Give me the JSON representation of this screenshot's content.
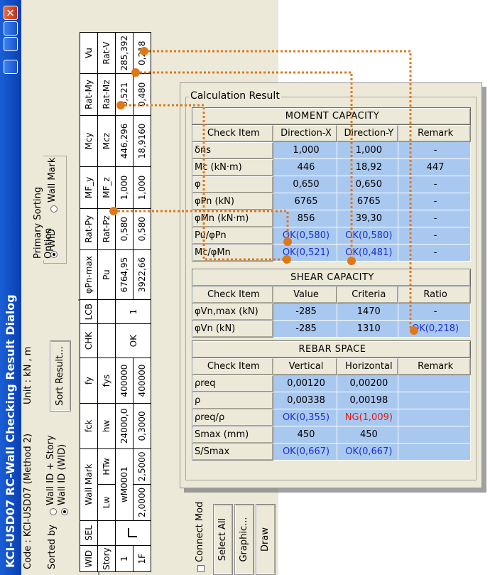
{
  "dialog": {
    "title": "KCI-USD07 RC-Wall Checking Result Dialog",
    "code": "Code : KCI-USD07 (Method 2)",
    "unit": "Unit : kN    ,   m",
    "sorted_by": "Sorted by",
    "sort_options": [
      "Wall ID + Story",
      "Wall ID (WID)"
    ],
    "sort_result_button": "Sort Result...",
    "primary_sorting": {
      "legend": "Primary Sorting Option",
      "options": [
        "WID",
        "Wall Mark"
      ]
    },
    "bottom_buttons": [
      "Connect Mod",
      "Select All",
      "Graphic...",
      "Draw"
    ],
    "table": {
      "header1": [
        "WID",
        "SEL",
        "Wall Mark",
        "",
        "fck",
        "fy",
        "CHK",
        "LCB",
        "φPn-max",
        "Rat-Py",
        "MF_y",
        "Mcy",
        "Rat-My",
        "Vu"
      ],
      "header2": [
        "Story",
        "",
        "Lw",
        "HTw",
        "hw",
        "fys",
        "",
        "",
        "Pu",
        "Rat-Pz",
        "MF_z",
        "Mcz",
        "Rat-Mz",
        "Rat-V"
      ],
      "row1": [
        "1",
        "",
        "wM0001",
        "",
        "24000,0",
        "400000",
        "OK",
        "1",
        "6764,95",
        "0,580",
        "1,000",
        "446,296",
        "0,521",
        "285,392"
      ],
      "row2": [
        "1F",
        "",
        "2,0000",
        "2,5000",
        "0,3000",
        "400000",
        "",
        "",
        "3922,66",
        "0,580",
        "1,000",
        "18,9160",
        "0,480",
        "0,218"
      ]
    }
  },
  "result": {
    "title": "Calculation Result",
    "moment": {
      "section": "MOMENT CAPACITY",
      "headers": [
        "Check Item",
        "Direction-X",
        "Direction-Y",
        "Remark"
      ],
      "rows": [
        {
          "label": "δns",
          "x": "1,000",
          "y": "1,000",
          "r": "-"
        },
        {
          "label": "Mc (kN·m)",
          "x": "446",
          "y": "18,92",
          "r": "447"
        },
        {
          "label": "φ",
          "x": "0,650",
          "y": "0,650",
          "r": "-"
        },
        {
          "label": "φPn (kN)",
          "x": "6765",
          "y": "6765",
          "r": "-"
        },
        {
          "label": "φMn (kN·m)",
          "x": "856",
          "y": "39,30",
          "r": "-"
        },
        {
          "label": "Pu/φPn",
          "x": "OK(0,580)",
          "y": "OK(0,580)",
          "r": "-"
        },
        {
          "label": "Mc/φMn",
          "x": "OK(0,521)",
          "y": "OK(0,481)",
          "r": "-"
        }
      ]
    },
    "shear": {
      "section": "SHEAR CAPACITY",
      "headers": [
        "Check Item",
        "Value",
        "Criteria",
        "Ratio"
      ],
      "rows": [
        {
          "label": "φVn,max (kN)",
          "a": "-285",
          "b": "1470",
          "c": "-"
        },
        {
          "label": "φVn (kN)",
          "a": "-285",
          "b": "1310",
          "c": "OK(0,218)"
        }
      ]
    },
    "rebar": {
      "section": "REBAR SPACE",
      "headers": [
        "Check Item",
        "Vertical",
        "Horizontal",
        "Remark"
      ],
      "rows": [
        {
          "label": "ρreq",
          "v": "0,00120",
          "h": "0,00200",
          "r": ""
        },
        {
          "label": "ρ",
          "v": "0,00338",
          "h": "0,00198",
          "r": ""
        },
        {
          "label": "ρreq/ρ",
          "v": "OK(0,355)",
          "h": "NG(1,009)",
          "r": ""
        },
        {
          "label": "Smax (mm)",
          "v": "450",
          "h": "450",
          "r": ""
        },
        {
          "label": "S/Smax",
          "v": "OK(0,667)",
          "h": "OK(0,667)",
          "r": ""
        }
      ]
    }
  },
  "colors": {
    "accent_dot": "#e07818",
    "ok": "#1a2fd0",
    "ng": "#e01818",
    "cell": "#a9c8f0"
  }
}
